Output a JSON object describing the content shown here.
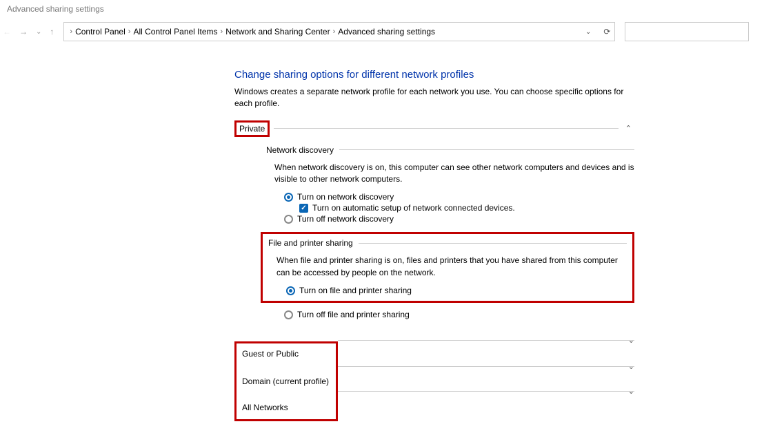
{
  "window": {
    "title": "Advanced sharing settings"
  },
  "breadcrumb": {
    "items": [
      "Control Panel",
      "All Control Panel Items",
      "Network and Sharing Center",
      "Advanced sharing settings"
    ]
  },
  "page": {
    "heading": "Change sharing options for different network profiles",
    "desc": "Windows creates a separate network profile for each network you use. You can choose specific options for each profile."
  },
  "sections": {
    "private": {
      "title": "Private",
      "netdisc": {
        "label": "Network discovery",
        "desc": "When network discovery is on, this computer can see other network computers and devices and is visible to other network computers.",
        "opt_on": "Turn on network discovery",
        "opt_auto": "Turn on automatic setup of network connected devices.",
        "opt_off": "Turn off network discovery"
      },
      "fps": {
        "label": "File and printer sharing",
        "desc": "When file and printer sharing is on, files and printers that you have shared from this computer can be accessed by people on the network.",
        "opt_on": "Turn on file and printer sharing",
        "opt_off": "Turn off file and printer sharing"
      }
    },
    "guest": {
      "title": "Guest or Public"
    },
    "domain": {
      "title": "Domain (current profile)"
    },
    "all": {
      "title": "All Networks"
    }
  }
}
